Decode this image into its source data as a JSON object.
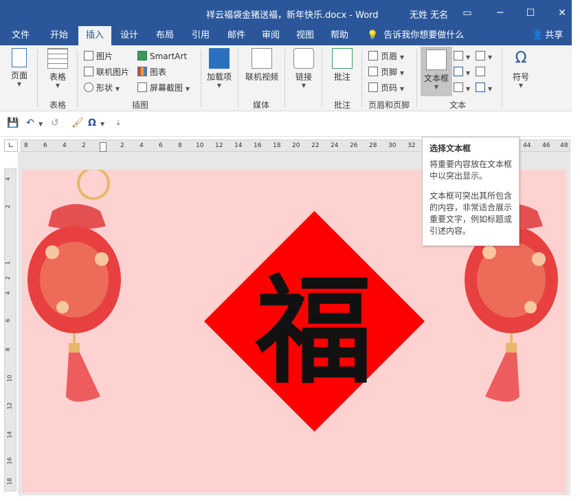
{
  "window": {
    "title": "祥云福袋金猪送福，新年快乐.docx  -  Word",
    "user": "无姓 无名",
    "controls": {
      "minimize": "─",
      "maximize": "☐",
      "close": "✕"
    }
  },
  "tabs": [
    {
      "label": "文件",
      "active": false
    },
    {
      "label": "开始",
      "active": false
    },
    {
      "label": "插入",
      "active": true
    },
    {
      "label": "设计",
      "active": false
    },
    {
      "label": "布局",
      "active": false
    },
    {
      "label": "引用",
      "active": false
    },
    {
      "label": "邮件",
      "active": false
    },
    {
      "label": "审阅",
      "active": false
    },
    {
      "label": "视图",
      "active": false
    },
    {
      "label": "帮助",
      "active": false
    }
  ],
  "tellme": "告诉我你想要做什么",
  "share": "共享",
  "ribbon": {
    "pages": {
      "button": "页面",
      "group": ""
    },
    "tables": {
      "button": "表格",
      "group": "表格"
    },
    "illustrations": {
      "group": "插图",
      "picture": "图片",
      "online_picture": "联机图片",
      "shapes": "形状",
      "smartart": "SmartArt",
      "chart": "图表",
      "screenshot": "屏幕截图"
    },
    "addins": {
      "button": "加载项"
    },
    "media": {
      "button": "联机视频",
      "group": "媒体"
    },
    "links": {
      "button": "链接"
    },
    "comments": {
      "button": "批注",
      "group": "批注"
    },
    "header_footer": {
      "group": "页眉和页脚",
      "header": "页眉",
      "footer": "页脚",
      "page_number": "页码"
    },
    "text": {
      "textbox": "文本框",
      "group": "文本"
    },
    "symbols": {
      "button": "符号"
    }
  },
  "ruler": {
    "horizontal": [
      "8",
      "6",
      "4",
      "2",
      "2",
      "4",
      "6",
      "8",
      "10",
      "12",
      "14",
      "16",
      "18",
      "20",
      "22",
      "24",
      "26",
      "28",
      "30",
      "32",
      "44",
      "46",
      "48"
    ],
    "vertical": [
      "4",
      "2",
      "1",
      "2",
      "4",
      "6",
      "8",
      "10",
      "12",
      "14",
      "16",
      "18"
    ]
  },
  "document": {
    "character": "福",
    "diamond_color": "#ff0000",
    "page_color": "#ffd2d2"
  },
  "tooltip": {
    "title": "选择文本框",
    "p1": "将重要内容放在文本框中以突出显示。",
    "p2": "文本框可突出其所包含的内容，非常适合展示重要文字，例如标题或引述内容。"
  },
  "colors": {
    "accent": "#2b579a"
  }
}
